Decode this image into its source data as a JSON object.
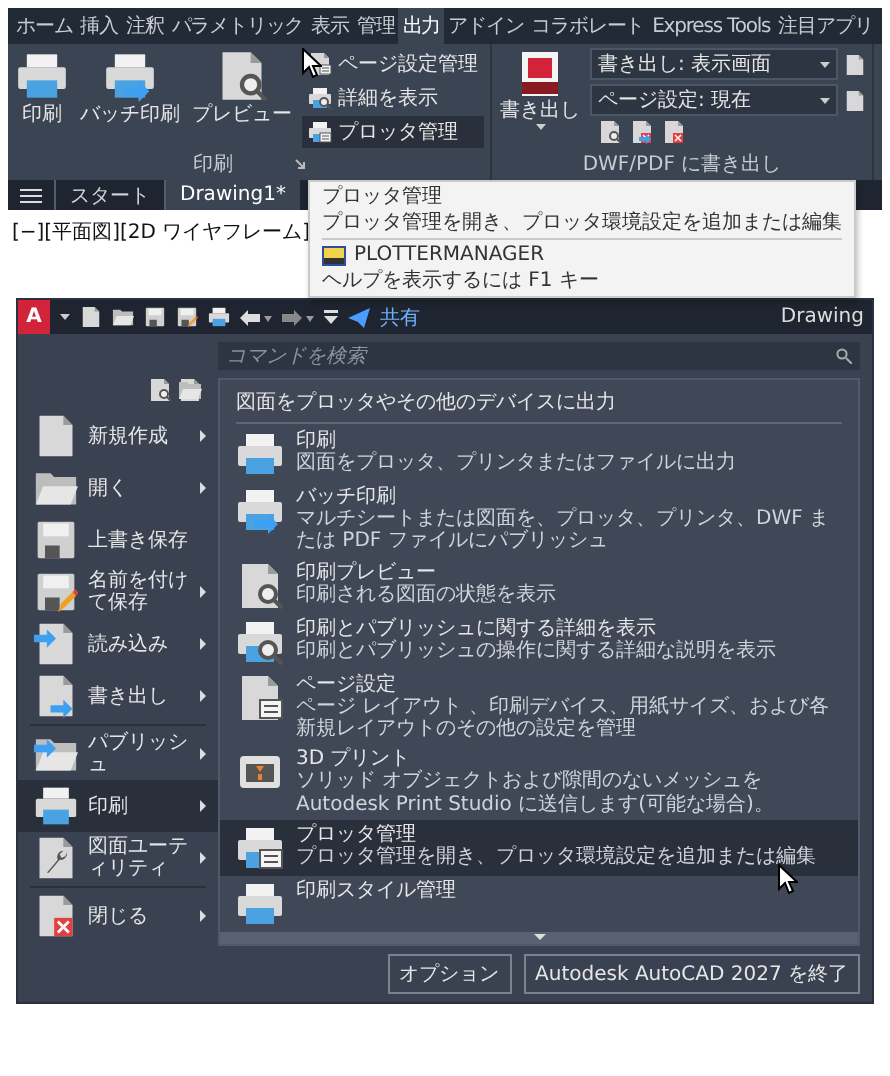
{
  "ribbon": {
    "tabs": [
      {
        "label": "ホーム",
        "selected": false
      },
      {
        "label": "挿入",
        "selected": false
      },
      {
        "label": "注釈",
        "selected": false
      },
      {
        "label": "パラメトリック",
        "selected": false
      },
      {
        "label": "表示",
        "selected": false
      },
      {
        "label": "管理",
        "selected": false
      },
      {
        "label": "出力",
        "selected": true
      },
      {
        "label": "アドイン",
        "selected": false
      },
      {
        "label": "コラボレート",
        "selected": false
      },
      {
        "label": "Express Tools",
        "selected": false
      },
      {
        "label": "注目アプリ",
        "selected": false
      }
    ],
    "print_panel": {
      "title": "印刷",
      "large_buttons": [
        "印刷",
        "バッチ印刷",
        "プレビュー"
      ],
      "small_buttons": [
        {
          "label": "ページ設定管理",
          "hovered": false
        },
        {
          "label": "詳細を表示",
          "hovered": false
        },
        {
          "label": "プロッタ管理",
          "hovered": true
        }
      ]
    },
    "export_panel": {
      "title": "DWF/PDF に書き出し",
      "button": "書き出し",
      "dropdowns": [
        "書き出し: 表示画面",
        "ページ設定: 現在"
      ]
    }
  },
  "file_tabs": [
    {
      "label": "スタート",
      "selected": false
    },
    {
      "label": "Drawing1*",
      "selected": true
    }
  ],
  "viewport_label": "[−][平面図][2D ワイヤフレーム]",
  "tooltip": {
    "title": "プロッタ管理",
    "description": "プロッタ管理を開き、プロッタ環境設定を追加または編集",
    "command": "PLOTTERMANAGER",
    "help": "ヘルプを表示するには F1 キー"
  },
  "app_menu": {
    "logo": "A",
    "share": "共有",
    "title": "Drawing",
    "search_placeholder": "コマンドを検索",
    "left_items": [
      {
        "label": "新規作成",
        "submenu": true,
        "selected": false,
        "separator_after": false
      },
      {
        "label": "開く",
        "submenu": true,
        "selected": false,
        "separator_after": false
      },
      {
        "label": "上書き保存",
        "submenu": false,
        "selected": false,
        "separator_after": false
      },
      {
        "label": "名前を付けて保存",
        "submenu": true,
        "selected": false,
        "separator_after": false
      },
      {
        "label": "読み込み",
        "submenu": true,
        "selected": false,
        "separator_after": false
      },
      {
        "label": "書き出し",
        "submenu": true,
        "selected": false,
        "separator_after": true
      },
      {
        "label": "パブリッシュ",
        "submenu": true,
        "selected": false,
        "separator_after": false
      },
      {
        "label": "印刷",
        "submenu": true,
        "selected": true,
        "separator_after": false
      },
      {
        "label": "図面ユーティリティ",
        "submenu": true,
        "selected": false,
        "separator_after": true
      },
      {
        "label": "閉じる",
        "submenu": true,
        "selected": false,
        "separator_after": false
      }
    ],
    "heading": "図面をプロッタやその他のデバイスに出力",
    "items": [
      {
        "title": "印刷",
        "description": "図面をプロッタ、プリンタまたはファイルに出力",
        "hovered": false
      },
      {
        "title": "バッチ印刷",
        "description": "マルチシートまたは図面を、プロッタ、プリンタ、DWF または PDF ファイルにパブリッシュ",
        "hovered": false
      },
      {
        "title": "印刷プレビュー",
        "description": "印刷される図面の状態を表示",
        "hovered": false
      },
      {
        "title": "印刷とパブリッシュに関する詳細を表示",
        "description": "印刷とパブリッシュの操作に関する詳細な説明を表示",
        "hovered": false
      },
      {
        "title": "ページ設定",
        "description": "ページ レイアウト 、印刷デバイス、用紙サイズ、および各新規レイアウトのその他の設定を管理",
        "hovered": false
      },
      {
        "title": "3D プリント",
        "description": "ソリッド オブジェクトおよび隙間のないメッシュを Autodesk Print Studio に送信します(可能な場合)。",
        "hovered": false
      },
      {
        "title": "プロッタ管理",
        "description": "プロッタ管理を開き、プロッタ環境設定を追加または編集",
        "hovered": true
      },
      {
        "title": "印刷スタイル管理",
        "hovered": false
      }
    ],
    "buttons": [
      "オプション",
      "Autodesk AutoCAD 2027 を終了"
    ]
  }
}
